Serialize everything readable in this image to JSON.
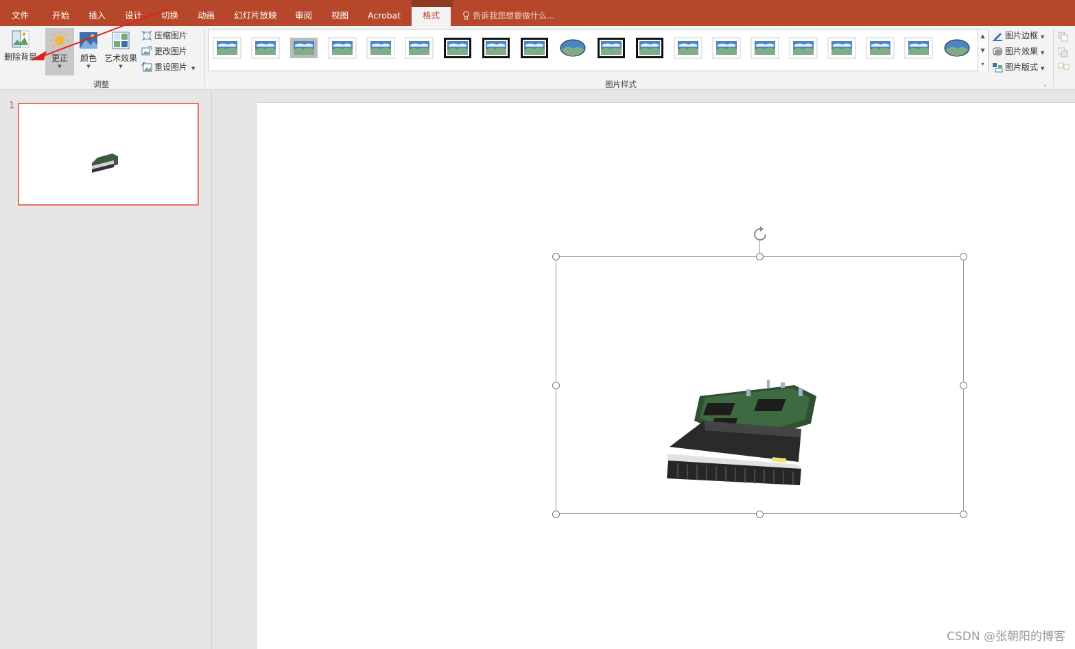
{
  "tabs": [
    {
      "label": "文件"
    },
    {
      "label": "开始"
    },
    {
      "label": "插入"
    },
    {
      "label": "设计"
    },
    {
      "label": "切换"
    },
    {
      "label": "动画"
    },
    {
      "label": "幻灯片放映"
    },
    {
      "label": "审阅"
    },
    {
      "label": "视图"
    },
    {
      "label": "Acrobat"
    },
    {
      "label": "格式",
      "active": true
    }
  ],
  "tell_me": "告诉我您想要做什么...",
  "ribbon": {
    "adjust": {
      "remove_background": "删除背景",
      "corrections": "更正",
      "color": "颜色",
      "artistic_effects": "艺术效果",
      "compress": "压缩图片",
      "change_picture": "更改图片",
      "reset_picture": "重设图片",
      "group_label": "调整"
    },
    "styles": {
      "group_label": "图片样式",
      "style_count": 20,
      "border": "图片边框",
      "effects": "图片效果",
      "layout": "图片版式"
    }
  },
  "slides": [
    {
      "number": "1"
    }
  ],
  "watermark": "CSDN @张朝阳的博客",
  "colors": {
    "accent": "#b7472a",
    "thumb_selection": "#e8735a",
    "arrow": "#e0201c"
  },
  "icons": [
    "remove-background-icon",
    "sun-icon",
    "color-icon",
    "artistic-effects-icon",
    "compress-icon",
    "change-picture-icon",
    "reset-picture-icon",
    "lightbulb-icon",
    "rotate-icon",
    "picture-border-icon",
    "picture-effects-icon",
    "picture-layout-icon"
  ]
}
